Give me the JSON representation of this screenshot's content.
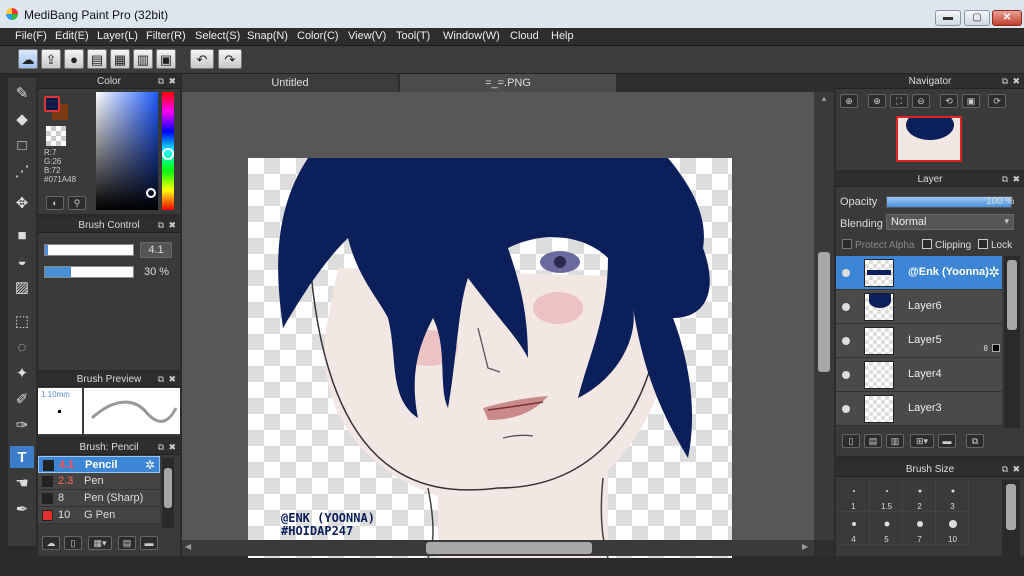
{
  "window": {
    "title": "MediBang Paint Pro (32bit)",
    "min": "▬",
    "max": "▢",
    "close": "✕"
  },
  "menu": [
    "File(F)",
    "Edit(E)",
    "Layer(L)",
    "Filter(R)",
    "Select(S)",
    "Snap(N)",
    "Color(C)",
    "View(V)",
    "Tool(T)",
    "Window(W)",
    "Cloud",
    "Help"
  ],
  "toolbar_icons": [
    "cloud-sync-icon",
    "share-icon",
    "speech-bubble-icon",
    "page-icon",
    "page-list-icon",
    "panel-layout-icon",
    "undo-icon",
    "redo-icon"
  ],
  "color_panel": {
    "title": "Color",
    "r": "R:7",
    "g": "G:26",
    "b": "B:72",
    "hex": "#071A48",
    "primary_color": "#071a48",
    "secondary_color": "#7a3a16"
  },
  "brush_control": {
    "title": "Brush Control",
    "size": "4.1",
    "opacity": "30 %",
    "size_fraction": 0.03,
    "opacity_fraction": 0.3
  },
  "brush_preview": {
    "title": "Brush Preview",
    "size": "1.10mm"
  },
  "brush_list": {
    "title": "Brush: Pencil",
    "items": [
      {
        "size": "4.1",
        "name": "Pencil",
        "selected": true,
        "swatch": "#333333"
      },
      {
        "size": "2.3",
        "name": "Pen",
        "selected": false,
        "swatch": "#333333"
      },
      {
        "size": "8",
        "name": "Pen (Sharp)",
        "selected": false,
        "swatch": "#333333"
      },
      {
        "size": "10",
        "name": "G Pen",
        "selected": false,
        "swatch": "#e03030"
      }
    ]
  },
  "canvas": {
    "tabs": [
      "Untitled",
      "=_=.PNG"
    ],
    "watermark_line1": "@ENK (YOONNA)",
    "watermark_line2": "#HOIDAP247",
    "hair_color": "#0b1f5a"
  },
  "navigator": {
    "title": "Navigator"
  },
  "layer_panel": {
    "title": "Layer",
    "opacity_label": "Opacity",
    "opacity_value": "100 %",
    "opacity_fraction": 1.0,
    "blending_label": "Blending",
    "blending_value": "Normal",
    "protect_alpha": "Protect Alpha",
    "clipping": "Clipping",
    "lock": "Lock",
    "layers": [
      {
        "name": "@Enk (Yoonna)",
        "selected": true,
        "badge": ""
      },
      {
        "name": "Layer6",
        "selected": false,
        "badge": ""
      },
      {
        "name": "Layer5",
        "selected": false,
        "badge": "8"
      },
      {
        "name": "Layer4",
        "selected": false,
        "badge": ""
      },
      {
        "name": "Layer3",
        "selected": false,
        "badge": ""
      }
    ]
  },
  "brush_size": {
    "title": "Brush Size",
    "labels": [
      "1",
      "1.5",
      "2",
      "3",
      "4",
      "5",
      "7",
      "10"
    ]
  }
}
